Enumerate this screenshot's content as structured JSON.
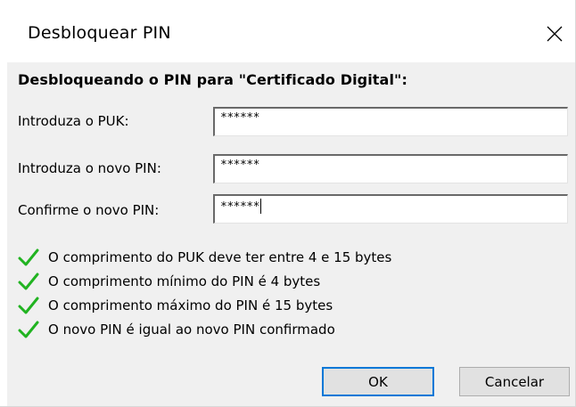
{
  "window": {
    "title": "Desbloquear PIN",
    "close_glyph": "close-icon"
  },
  "dialog": {
    "heading": "Desbloqueando o PIN para \"Certificado Digital\":",
    "fields": [
      {
        "label": "Introduza o PUK:",
        "value": "******"
      },
      {
        "label": "Introduza o novo PIN:",
        "value": "******"
      },
      {
        "label": "Confirme o novo PIN:",
        "value": "******"
      }
    ],
    "rules": [
      {
        "text": "O comprimento do PUK deve ter entre 4 e 15 bytes",
        "icon": "check-icon"
      },
      {
        "text": "O comprimento mínimo do PIN é 4 bytes",
        "icon": "check-icon"
      },
      {
        "text": "O comprimento máximo do PIN é 15 bytes",
        "icon": "check-icon"
      },
      {
        "text": "O novo PIN é igual ao novo PIN confirmado",
        "icon": "check-icon"
      }
    ],
    "buttons": {
      "ok_label": "OK",
      "cancel_label": "Cancelar"
    }
  },
  "colors": {
    "client_background": "#f0f0f0",
    "check_green": "#21b321",
    "default_button_border": "#0078d7",
    "button_face": "#e1e1e1"
  }
}
